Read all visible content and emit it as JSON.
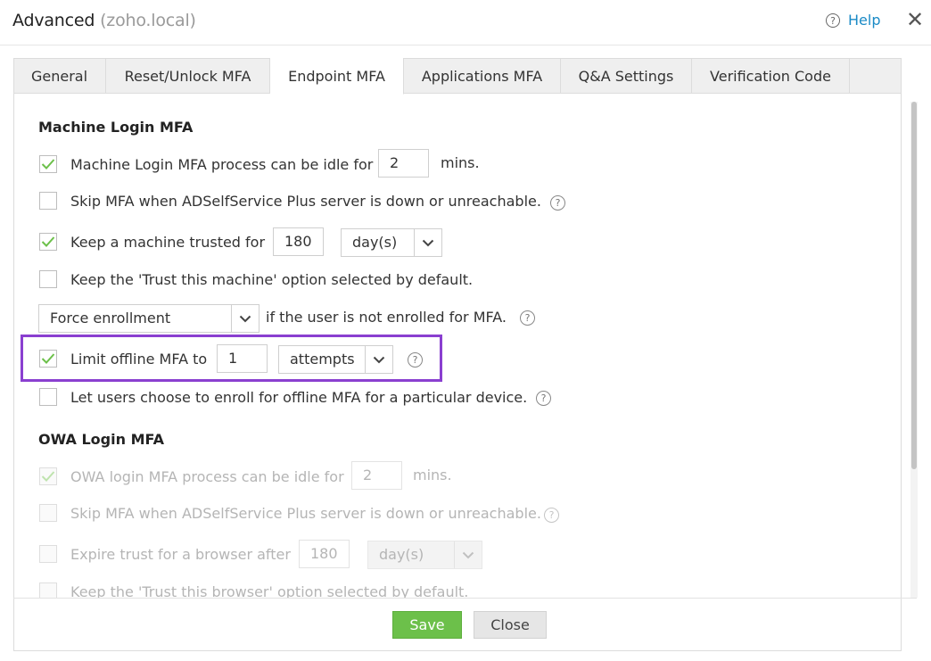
{
  "dialog": {
    "title": "Advanced",
    "subtitle": "(zoho.local)",
    "help_icon": "?",
    "help_label": "Help",
    "close_glyph": "✕"
  },
  "tabs": [
    {
      "label": "General"
    },
    {
      "label": "Reset/Unlock MFA"
    },
    {
      "label": "Endpoint MFA",
      "active": true
    },
    {
      "label": "Applications MFA"
    },
    {
      "label": "Q&A Settings"
    },
    {
      "label": "Verification Code"
    }
  ],
  "machine": {
    "title": "Machine Login MFA",
    "idle": {
      "checked": true,
      "label": "Machine Login MFA process can be idle for",
      "value": "2",
      "suffix": "mins."
    },
    "skip": {
      "checked": false,
      "label": "Skip MFA when ADSelfService Plus server is down or unreachable."
    },
    "trust": {
      "checked": true,
      "label": "Keep a machine trusted for",
      "value": "180",
      "unit": "day(s)"
    },
    "trust_default": {
      "checked": false,
      "label": "Keep the 'Trust this machine' option selected by default."
    },
    "enroll": {
      "selected": "Force enrollment",
      "label": "if the user is not enrolled for MFA."
    },
    "offline": {
      "checked": true,
      "label": "Limit offline MFA to",
      "value": "1",
      "unit": "attempts"
    },
    "offline_choose": {
      "checked": false,
      "label": "Let users choose to enroll for offline MFA for a particular device."
    }
  },
  "owa": {
    "title": "OWA Login MFA",
    "idle": {
      "checked": true,
      "label": "OWA login MFA process can be idle for",
      "value": "2",
      "suffix": "mins."
    },
    "skip": {
      "checked": false,
      "label": "Skip MFA when ADSelfService Plus server is down or unreachable."
    },
    "expire": {
      "checked": false,
      "label": "Expire trust for a browser after",
      "value": "180",
      "unit": "day(s)"
    },
    "trust_default": {
      "checked": false,
      "label": "Keep the 'Trust this browser' option selected by default."
    }
  },
  "info_icon": "?",
  "footer": {
    "save_label": "Save",
    "close_label": "Close"
  },
  "colors": {
    "accent_green": "#6cc04a",
    "highlight_purple": "#8a3fd0",
    "link_blue": "#1a8ac6"
  }
}
